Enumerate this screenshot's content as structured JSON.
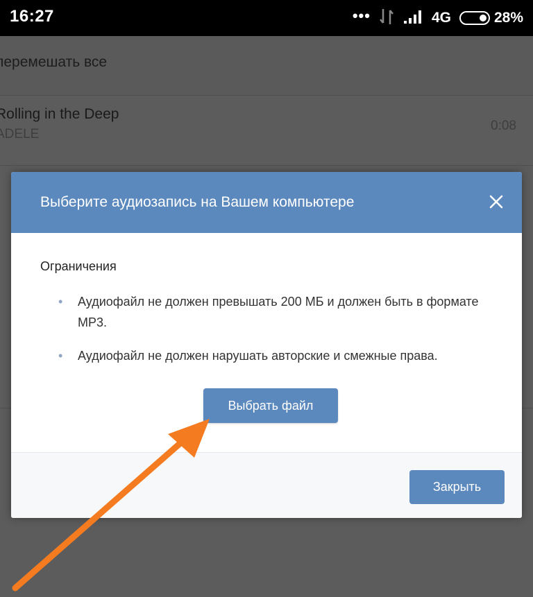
{
  "status_bar": {
    "time": "16:27",
    "dots": "•••",
    "network_type": "4G",
    "battery_percent": "28%",
    "battery_level": 0.28
  },
  "background": {
    "shuffle_label": "перемешать все",
    "track": {
      "title": "Rolling in the Deep",
      "artist": "ADELE",
      "duration": "0:08"
    }
  },
  "dialog": {
    "title": "Выберите аудиозапись на Вашем компьютере",
    "section_title": "Ограничения",
    "rules": [
      "Аудиофайл не должен превышать 200 МБ и должен быть в формате MP3.",
      "Аудиофайл не должен нарушать авторские и смежные права."
    ],
    "choose_file_label": "Выбрать файл",
    "close_label": "Закрыть"
  },
  "colors": {
    "accent": "#5b88bd",
    "annotation_arrow": "#f47b20",
    "overlay": "#5b5b5b"
  },
  "icons": {
    "close": "close-icon",
    "signal": "signal-icon",
    "network_activity": "network-activity-icon",
    "battery": "battery-icon"
  }
}
